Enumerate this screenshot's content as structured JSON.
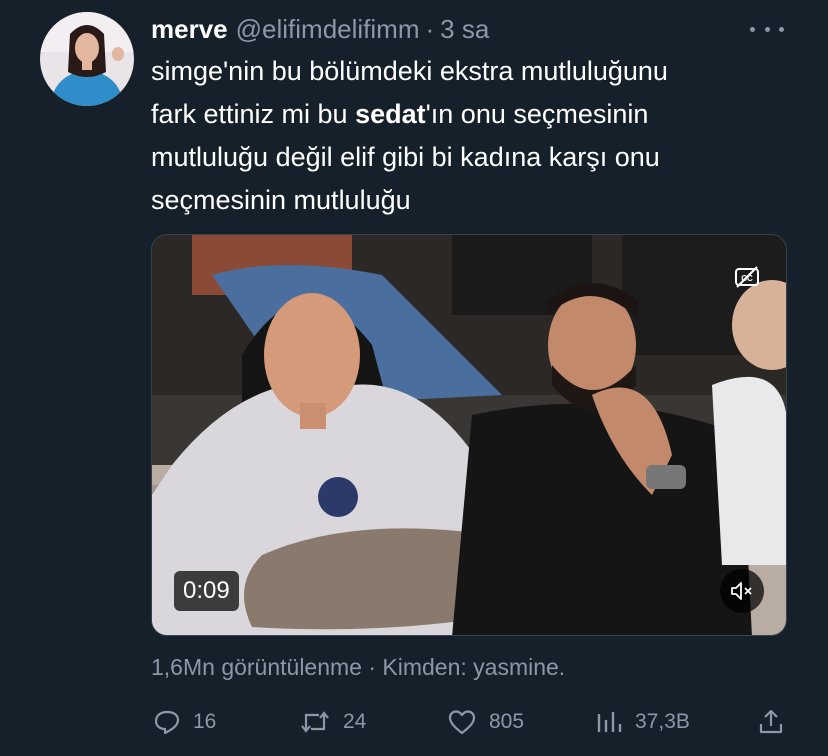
{
  "user": {
    "display_name": "merve",
    "handle": "@elifimdelifimm",
    "separator": "·",
    "time": "3 sa"
  },
  "tweet": {
    "line1": "simge'nin bu bölümdeki ekstra mutluluğunu",
    "line2_pre": "fark ettiniz mi bu ",
    "line2_bold": "sedat",
    "line2_post": "'ın onu seçmesinin",
    "line3": "mutluluğu değil elif gibi bi kadına karşı onu",
    "line4": "seçmesinin mutluluğu"
  },
  "video": {
    "timecode": "0:09",
    "captions_icon": "closed-captions-off-icon",
    "mute_icon": "speaker-muted-icon"
  },
  "meta": {
    "views": "1,6Mn görüntülenme · Kimden: yasmine."
  },
  "actions": {
    "replies": "16",
    "retweets": "24",
    "likes": "805",
    "impressions": "37,3B"
  },
  "colors": {
    "background": "#15202b",
    "secondary_text": "#8b98a5",
    "primary_text": "#ffffff"
  }
}
